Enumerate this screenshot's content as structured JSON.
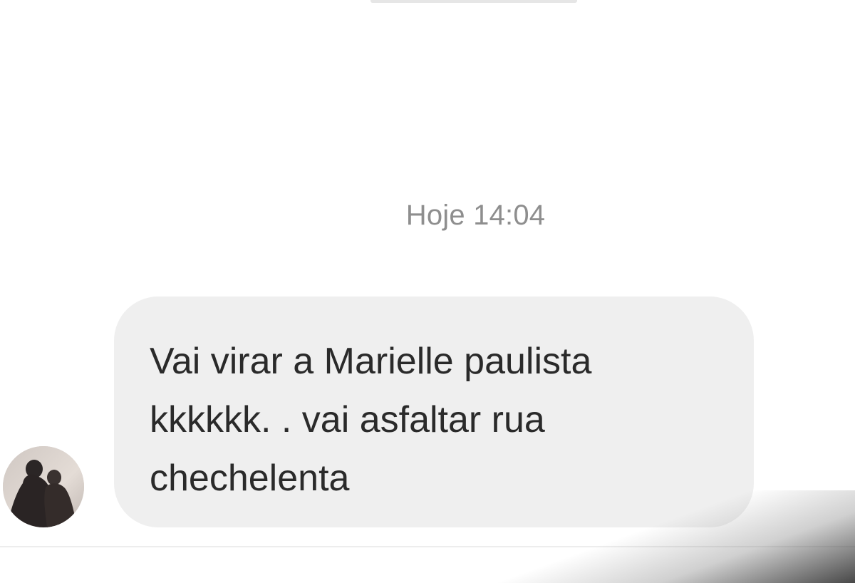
{
  "conversation": {
    "timestamp": "Hoje 14:04",
    "messages": [
      {
        "direction": "incoming",
        "text": "Vai virar a Marielle paulista\nkkkkkk. .  vai asfaltar rua\nchechelenta"
      }
    ]
  },
  "colors": {
    "background": "#ffffff",
    "bubble": "#efefef",
    "timestamp_text": "#8e8e8e",
    "message_text": "#2a2a2a"
  },
  "icons": {
    "sender_avatar": "avatar-photo"
  }
}
